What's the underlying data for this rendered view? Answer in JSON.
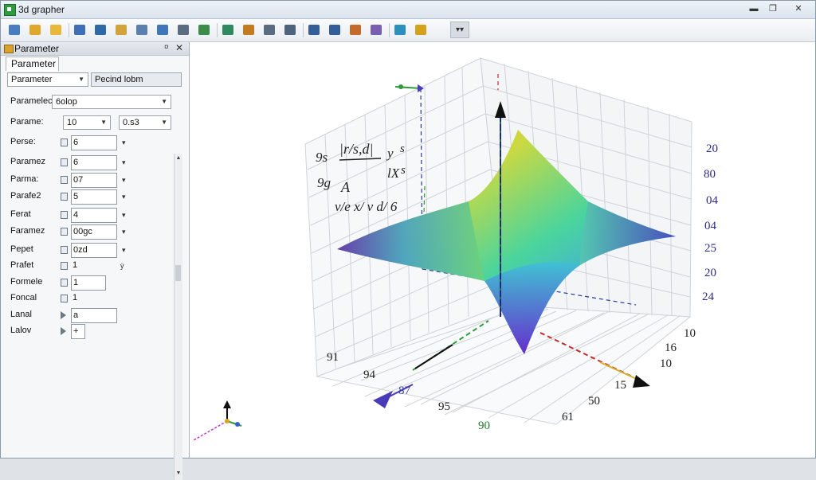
{
  "window": {
    "title": "3d grapher",
    "min": "▬",
    "max": "❐",
    "close": "✕"
  },
  "toolbar": {
    "buttons": [
      {
        "name": "new-file-icon",
        "color": "#4a7cc2"
      },
      {
        "name": "open-folder-icon",
        "color": "#e0a82a"
      },
      {
        "name": "edit-icon",
        "color": "#e8b83a"
      },
      {
        "name": "copy-icon",
        "color": "#3f6fb8"
      },
      {
        "name": "rotate-icon",
        "color": "#2f6aa8"
      },
      {
        "name": "function-icon",
        "color": "#d2a33a"
      },
      {
        "name": "link-icon",
        "color": "#5b7fae"
      },
      {
        "name": "surface-icon",
        "color": "#3d77b9"
      },
      {
        "name": "cursor-icon",
        "color": "#5b6c80"
      },
      {
        "name": "axis-icon",
        "color": "#3b8e4a"
      },
      {
        "name": "vector-icon",
        "color": "#2f8a5f"
      },
      {
        "name": "pin-icon",
        "color": "#c47a1e"
      },
      {
        "name": "split-icon",
        "color": "#5b6c80"
      },
      {
        "name": "arrange-icon",
        "color": "#4f6380"
      },
      {
        "name": "zoom-in-icon",
        "color": "#345e99"
      },
      {
        "name": "zoom-out-icon",
        "color": "#345e99"
      },
      {
        "name": "palette-icon",
        "color": "#c46a2a"
      },
      {
        "name": "layers-icon",
        "color": "#7a5fb0"
      },
      {
        "name": "render-icon",
        "color": "#2c8fbe"
      },
      {
        "name": "star-icon",
        "color": "#d4a21a"
      }
    ],
    "more": "▾▾"
  },
  "panel": {
    "title": "Parameter",
    "pin": "¤",
    "close": "✕",
    "tab": "Parameter",
    "select_main": "Parameter",
    "select_main_right": "Pecind lobm",
    "rows": [
      {
        "label": "Paramelec",
        "value": "6olop",
        "type": "wide-select"
      },
      {
        "label": "Parame:",
        "value": "10",
        "value2": "0.s3",
        "type": "double-select"
      },
      {
        "label": "Perse:",
        "value": "6",
        "mark": "▾"
      },
      {
        "label": "Paramez",
        "value": "6",
        "mark": "▾"
      },
      {
        "label": "Parma:",
        "value": "07",
        "mark": "▾"
      },
      {
        "label": "Parafe2",
        "value": "5",
        "mark": "▾"
      },
      {
        "label": "Ferat",
        "value": "4",
        "mark": "▾"
      },
      {
        "label": "Faramez",
        "value": "00gc",
        "mark": "▾"
      },
      {
        "label": "Pepet",
        "value": "0zd",
        "mark": "▾"
      },
      {
        "label": "Prafet",
        "value": "1",
        "mark": "ÿ"
      },
      {
        "label": "Formele",
        "value": "1"
      },
      {
        "label": "Foncal",
        "value": "1"
      },
      {
        "label": "Lanal",
        "value": "a"
      },
      {
        "label": "Lalov",
        "value": "+"
      }
    ]
  },
  "graph": {
    "formula": {
      "l1a": "9s",
      "l1b": "|r/s,d|",
      "l1c": "y",
      "l1d": "s",
      "l2a": "9g",
      "l2b": "A",
      "l2c": "lX",
      "l2d": "s",
      "l3": "v/e  x/  v  d/  6"
    },
    "right_ticks": [
      "20",
      "80",
      "04",
      "04",
      "25",
      "20",
      "24"
    ],
    "right_low_ticks": [
      "10",
      "16",
      "10",
      "15",
      "50",
      "61"
    ],
    "bottom_ticks": [
      "91",
      "94",
      "87",
      "95",
      "90"
    ]
  }
}
